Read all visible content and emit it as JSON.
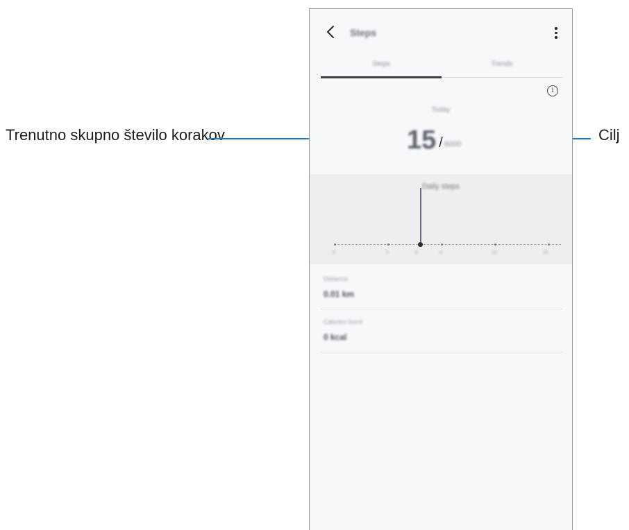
{
  "callouts": {
    "left": "Trenutno skupno število korakov",
    "right": "Cilj"
  },
  "screen": {
    "title": "Steps",
    "tabs": [
      {
        "label": "Steps"
      },
      {
        "label": "Trends"
      }
    ],
    "period": "Today",
    "steps_today": "15",
    "slash": "/",
    "goal": "6000",
    "daily_goal_label": "Daily steps",
    "chart": {
      "x_labels": [
        "0",
        "3",
        "6",
        "9",
        "12",
        "15"
      ]
    },
    "stats": [
      {
        "title": "Distance",
        "value": "0.01 km"
      },
      {
        "title": "Calories burnt",
        "value": "0 kcal"
      }
    ]
  },
  "colors": {
    "callout_line": "#1f7ab8",
    "screen_background": "#f7f8fa",
    "chart_background": "#eeeeee"
  }
}
